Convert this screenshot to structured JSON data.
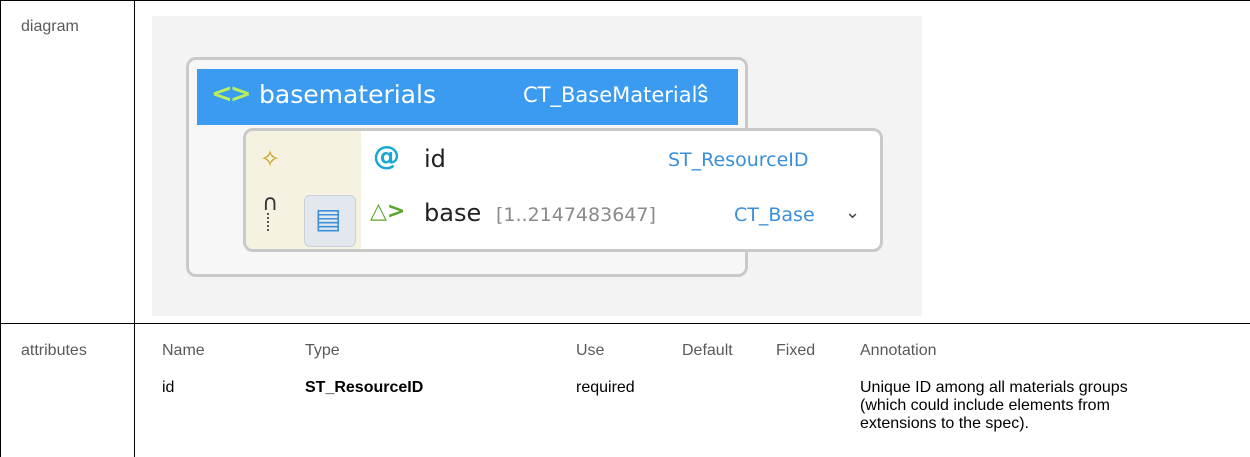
{
  "rows": {
    "diagram_label": "diagram",
    "attributes_label": "attributes"
  },
  "diagram": {
    "element": {
      "icon": "element-icon",
      "name": "basematerials",
      "type": "CT_BaseMaterials",
      "toggle_icon": "collapse-chevron-icon"
    },
    "attribute_row": {
      "icon": "attribute-at-icon",
      "name": "id",
      "type": "ST_ResourceID"
    },
    "child_row": {
      "icon": "element-reference-icon",
      "name": "base",
      "occurrence": "[1..2147483647]",
      "type": "CT_Base",
      "toggle_icon": "expand-chevron-icon"
    }
  },
  "attributes": {
    "headers": [
      "Name",
      "Type",
      "Use",
      "Default",
      "Fixed",
      "Annotation"
    ],
    "rows": [
      {
        "name": "id",
        "type": "ST_ResourceID",
        "use": "required",
        "default": "",
        "fixed": "",
        "annotation_lines": [
          "Unique ID among all materials groups",
          "(which could include elements from",
          "extensions to the spec)."
        ]
      }
    ]
  }
}
